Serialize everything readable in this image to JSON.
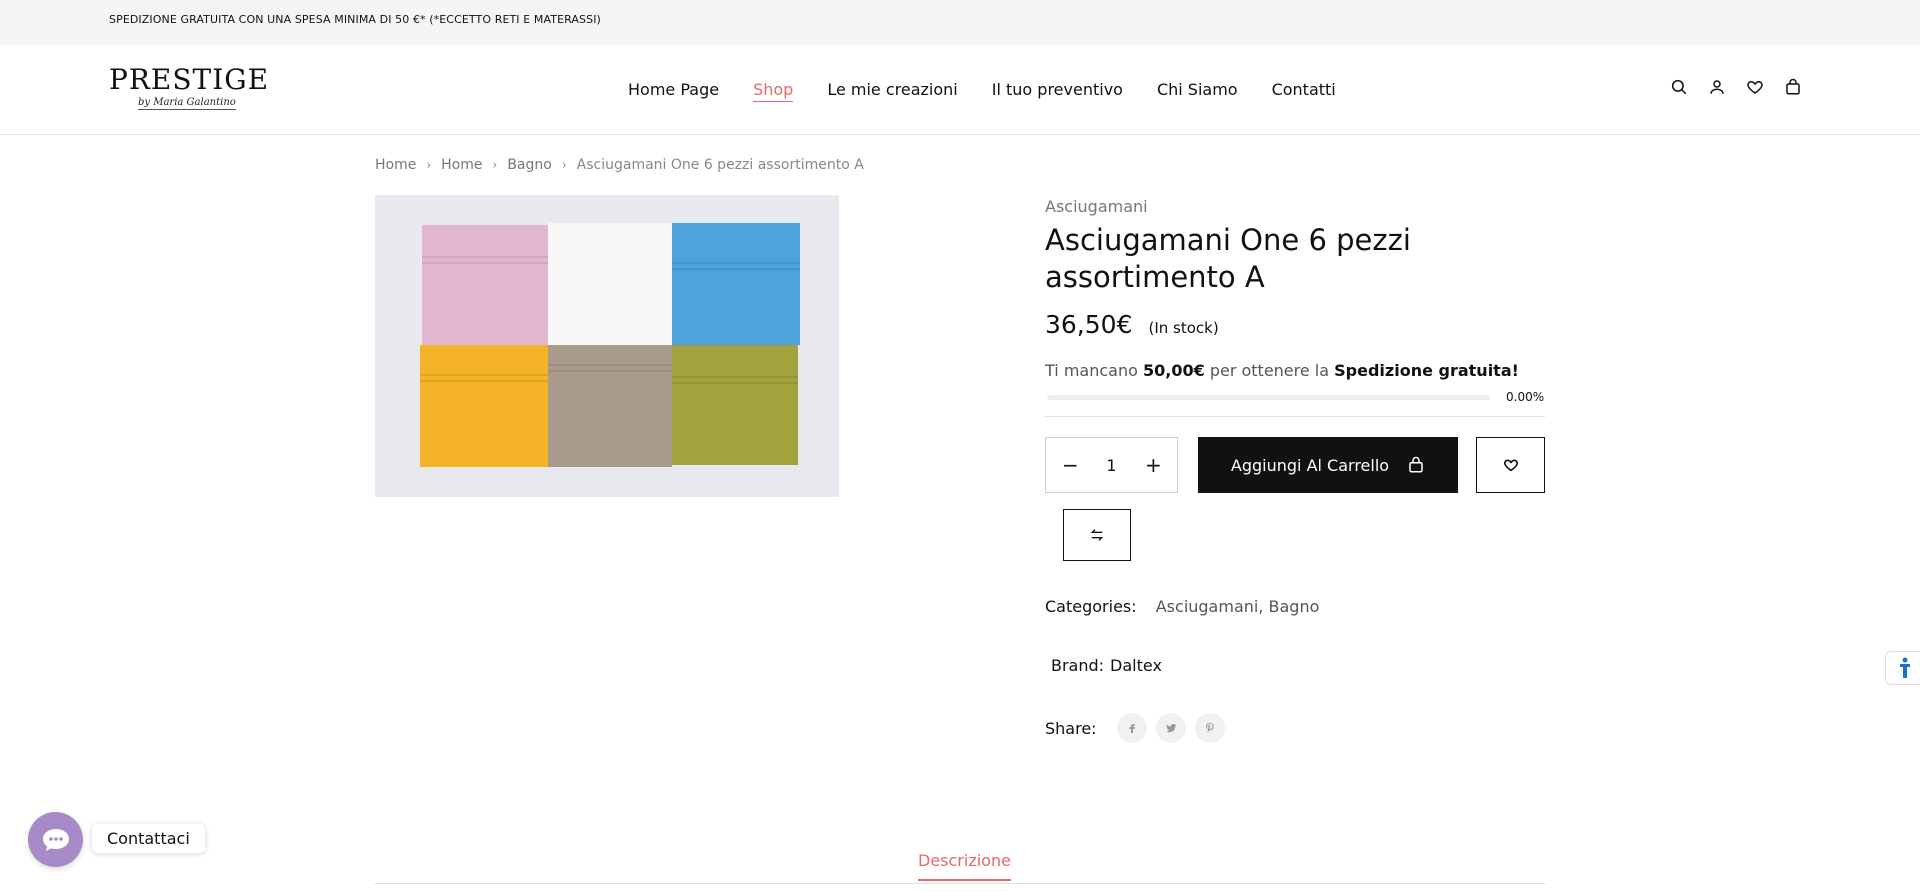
{
  "topbar": {
    "text": "SPEDIZIONE GRATUITA CON UNA SPESA MINIMA DI 50 €*  (*ECCETTO RETI E MATERASSI)"
  },
  "logo": {
    "name": "PRESTIGE",
    "subtitle": "by Maria Galantino"
  },
  "nav": {
    "items": [
      {
        "label": "Home Page",
        "active": false
      },
      {
        "label": "Shop",
        "active": true
      },
      {
        "label": "Le mie creazioni",
        "active": false
      },
      {
        "label": "Il tuo preventivo",
        "active": false
      },
      {
        "label": "Chi Siamo",
        "active": false
      },
      {
        "label": "Contatti",
        "active": false
      }
    ]
  },
  "header_icons": [
    "search-icon",
    "user-icon",
    "heart-icon",
    "bag-icon"
  ],
  "breadcrumb": {
    "items": [
      "Home",
      "Home",
      "Bagno"
    ],
    "current": "Asciugamani One 6 pezzi assortimento A"
  },
  "product": {
    "category": "Asciugamani",
    "title": "Asciugamani One 6 pezzi assortimento A",
    "price": "36,50€",
    "stock": "(In stock)",
    "shipping": {
      "prefix": "Ti mancano",
      "amount": "50,00€",
      "middle": "per ottenere la",
      "goal": "Spedizione gratuita!",
      "progress": 0,
      "progress_label": "0.00%"
    },
    "quantity": "1",
    "add_to_cart_label": "Aggiungi Al Carrello",
    "categories_label": "Categories:",
    "categories_value": "Asciugamani, Bagno",
    "brand_label": "Brand:",
    "brand_value": "Daltex",
    "share_label": "Share:",
    "share_icons": [
      "facebook-icon",
      "twitter-icon",
      "pinterest-icon"
    ],
    "towel_colors": [
      "#e3b6cf",
      "#f7f7f8",
      "#4ea3db",
      "#f4b227",
      "#a89b8b",
      "#a2a33c"
    ]
  },
  "tabs": {
    "description_label": "Descrizione"
  },
  "chat": {
    "label": "Contattaci"
  },
  "colors": {
    "accent": "#e56a6a",
    "primary": "#111111",
    "chat": "#a78bc9"
  }
}
